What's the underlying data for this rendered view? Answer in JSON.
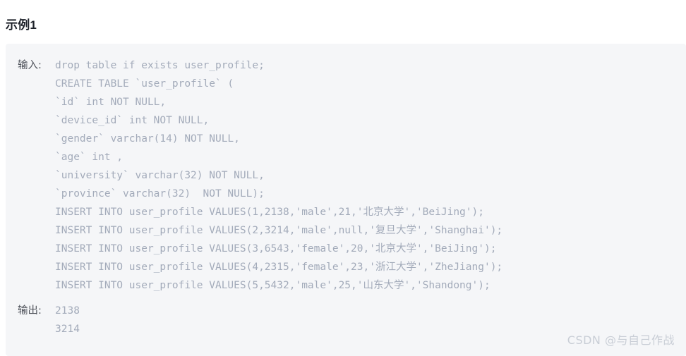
{
  "page": {
    "title": "示例1",
    "background_color": "#ffffff"
  },
  "code_block": {
    "background_color": "#f5f6f8",
    "text_color": "#a3abba",
    "label_color": "#4d5159",
    "input": {
      "label": "输入:",
      "lines": [
        "drop table if exists user_profile;",
        "CREATE TABLE `user_profile` (",
        "`id` int NOT NULL,",
        "`device_id` int NOT NULL,",
        "`gender` varchar(14) NOT NULL,",
        "`age` int ,",
        "`university` varchar(32) NOT NULL,",
        "`province` varchar(32)  NOT NULL);",
        "INSERT INTO user_profile VALUES(1,2138,'male',21,'北京大学','BeiJing');",
        "INSERT INTO user_profile VALUES(2,3214,'male',null,'复旦大学','Shanghai');",
        "INSERT INTO user_profile VALUES(3,6543,'female',20,'北京大学','BeiJing');",
        "INSERT INTO user_profile VALUES(4,2315,'female',23,'浙江大学','ZheJiang');",
        "INSERT INTO user_profile VALUES(5,5432,'male',25,'山东大学','Shandong');"
      ]
    },
    "output": {
      "label": "输出:",
      "lines": [
        "2138",
        "3214"
      ]
    }
  },
  "watermark": {
    "text": "CSDN @与自己作战",
    "color": "#c9ced6"
  }
}
